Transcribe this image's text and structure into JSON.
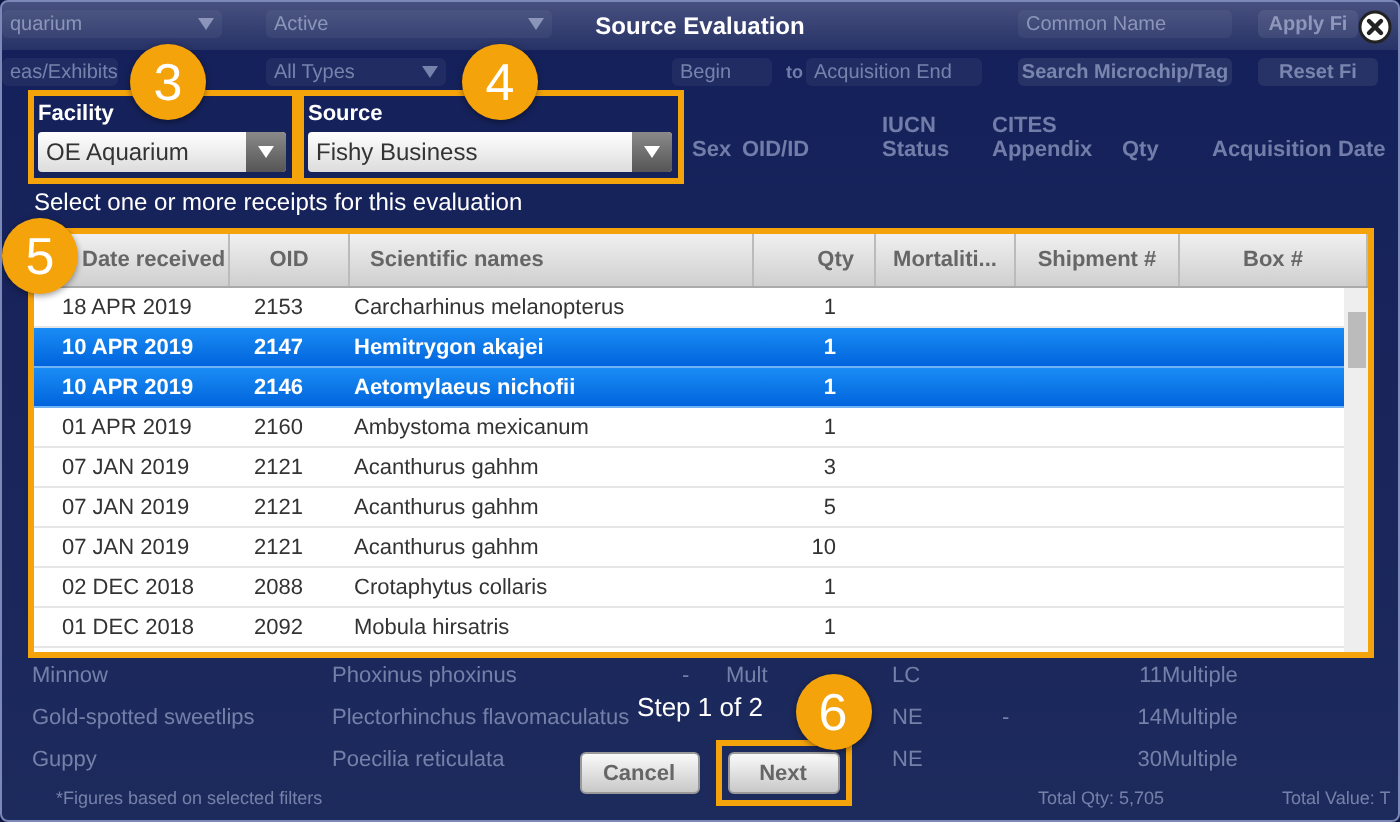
{
  "background": {
    "filters_row_1": [
      {
        "kind": "dropdown",
        "value": "quarium"
      },
      {
        "kind": "dropdown",
        "value": "Active"
      },
      {
        "kind": "field",
        "placeholder": "Common Name"
      },
      {
        "kind": "button",
        "label": "Apply Fi"
      }
    ],
    "filters_row_2": [
      {
        "kind": "dropdown",
        "value": "eas/Exhibits"
      },
      {
        "kind": "dropdown",
        "value": "All Types"
      },
      {
        "kind": "field",
        "placeholder": "Begin"
      },
      {
        "kind": "text",
        "label": "to"
      },
      {
        "kind": "field",
        "placeholder": "Acquisition End"
      },
      {
        "kind": "button",
        "label": "Search Microchip/Tag"
      },
      {
        "kind": "button",
        "label": "Reset Fi"
      }
    ],
    "table_header": [
      "Sex",
      "OID/ID",
      "IUCN Status",
      "CITES Appendix",
      "Qty",
      "Acquisition Date"
    ],
    "summary_rows": [
      [
        "Minnow",
        "Phoxinus phoxinus",
        "-",
        "Mult",
        "LC",
        "",
        "11",
        "Multiple"
      ],
      [
        "Gold-spotted sweetlips",
        "Plectorhinchus flavomaculatus",
        "",
        "",
        "NE",
        "-",
        "14",
        "Multiple"
      ],
      [
        "Guppy",
        "Poecilia reticulata",
        "",
        "",
        "NE",
        "",
        "30",
        "Multiple"
      ]
    ],
    "footer": {
      "note": "*Figures based on selected filters",
      "total_qty": "Total Qty: 5,705",
      "total_value": "Total Value: T"
    }
  },
  "dialog": {
    "title": "Source Evaluation",
    "fields": [
      {
        "label": "Facility",
        "value": "OE Aquarium",
        "callout": "3"
      },
      {
        "label": "Source",
        "value": "Fishy Business",
        "callout": "4"
      }
    ],
    "instruction": "Select one or more receipts for this evaluation",
    "table": {
      "callout": "5",
      "columns": [
        "Date received",
        "OID",
        "Scientific names",
        "Qty",
        "Mortaliti...",
        "Shipment #",
        "Box #"
      ],
      "rows": [
        {
          "date_received": "18 APR 2019",
          "oid": "2153",
          "scientific_name": "Carcharhinus melanopterus",
          "qty": "1",
          "selected": false
        },
        {
          "date_received": "10 APR 2019",
          "oid": "2147",
          "scientific_name": "Hemitrygon akajei",
          "qty": "1",
          "selected": true
        },
        {
          "date_received": "10 APR 2019",
          "oid": "2146",
          "scientific_name": "Aetomylaeus nichofii",
          "qty": "1",
          "selected": true
        },
        {
          "date_received": "01 APR 2019",
          "oid": "2160",
          "scientific_name": "Ambystoma mexicanum",
          "qty": "1",
          "selected": false
        },
        {
          "date_received": "07 JAN 2019",
          "oid": "2121",
          "scientific_name": "Acanthurus gahhm",
          "qty": "3",
          "selected": false
        },
        {
          "date_received": "07 JAN 2019",
          "oid": "2121",
          "scientific_name": "Acanthurus gahhm",
          "qty": "5",
          "selected": false
        },
        {
          "date_received": "07 JAN 2019",
          "oid": "2121",
          "scientific_name": "Acanthurus gahhm",
          "qty": "10",
          "selected": false
        },
        {
          "date_received": "02 DEC 2018",
          "oid": "2088",
          "scientific_name": "Crotaphytus collaris",
          "qty": "1",
          "selected": false
        },
        {
          "date_received": "01 DEC 2018",
          "oid": "2092",
          "scientific_name": "Mobula hirsatris",
          "qty": "1",
          "selected": false
        }
      ]
    },
    "step": "Step 1 of 2",
    "buttons": [
      {
        "label": "Cancel"
      },
      {
        "label": "Next",
        "callout": "6"
      }
    ]
  }
}
